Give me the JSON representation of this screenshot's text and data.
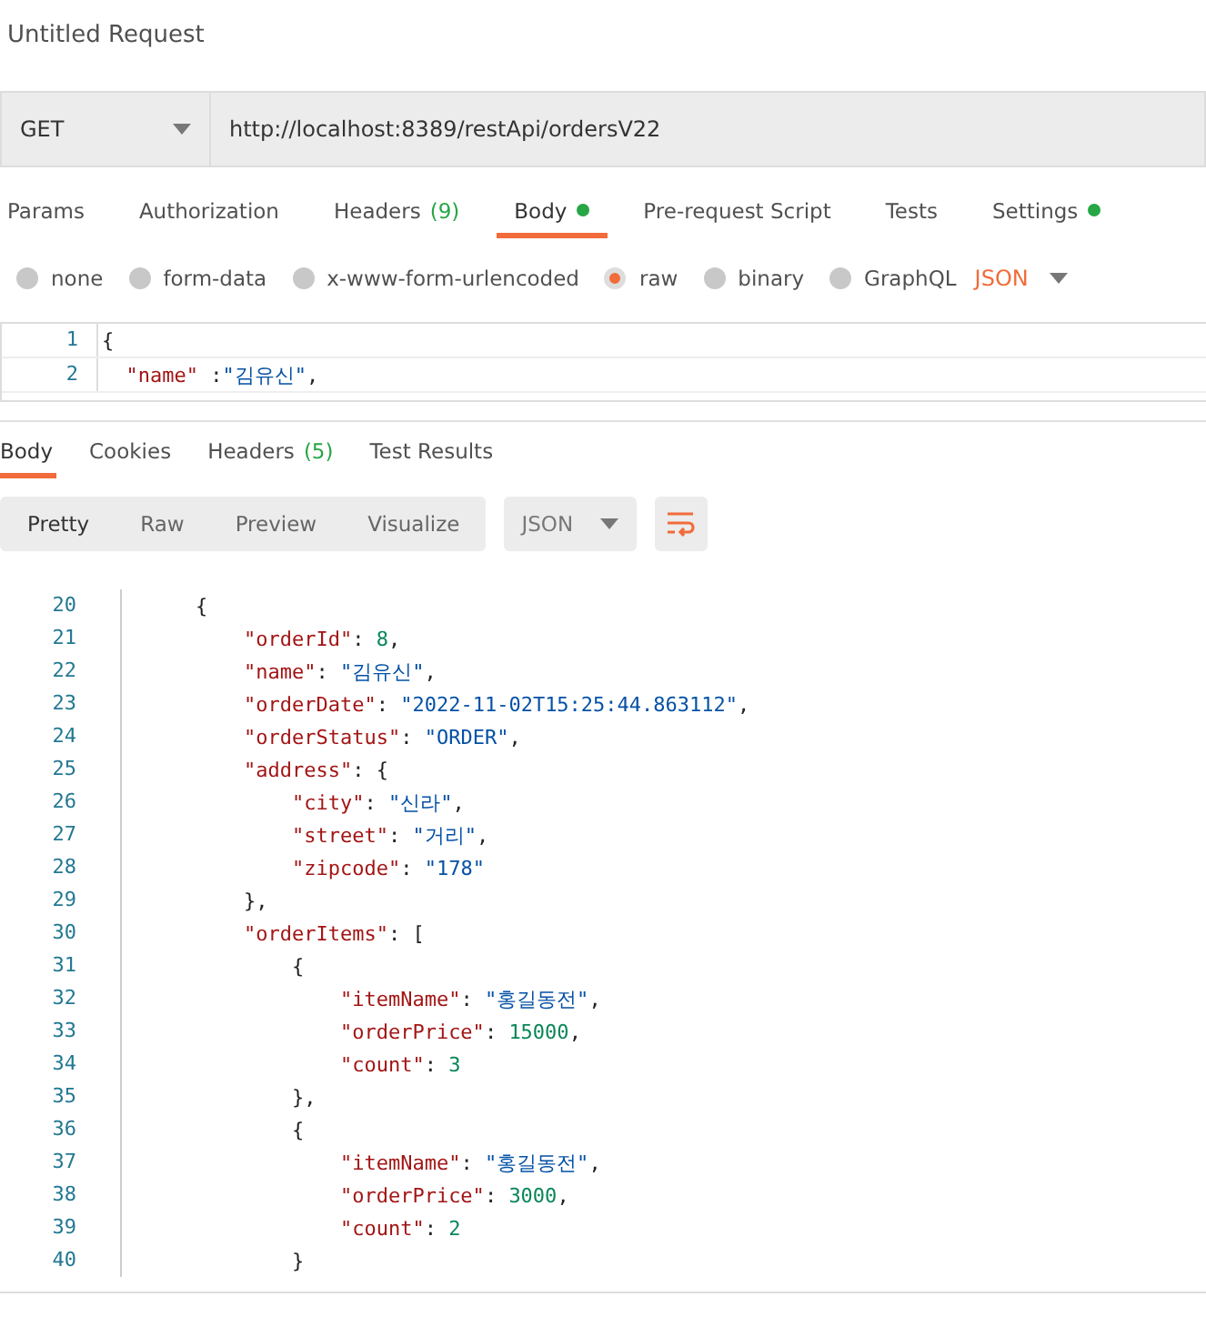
{
  "title": "Untitled Request",
  "request": {
    "method": "GET",
    "url": "http://localhost:8389/restApi/ordersV22"
  },
  "tabs": [
    {
      "label": "Params",
      "selected": false
    },
    {
      "label": "Authorization",
      "selected": false
    },
    {
      "label": "Headers",
      "count": "(9)",
      "selected": false
    },
    {
      "label": "Body",
      "dot": true,
      "selected": true
    },
    {
      "label": "Pre-request Script",
      "selected": false
    },
    {
      "label": "Tests",
      "selected": false
    },
    {
      "label": "Settings",
      "dot": true,
      "selected": false
    }
  ],
  "body_types": [
    {
      "label": "none",
      "selected": false
    },
    {
      "label": "form-data",
      "selected": false
    },
    {
      "label": "x-www-form-urlencoded",
      "selected": false
    },
    {
      "label": "raw",
      "selected": true
    },
    {
      "label": "binary",
      "selected": false
    },
    {
      "label": "GraphQL",
      "selected": false
    }
  ],
  "raw_format": "JSON",
  "editor_lines": [
    {
      "number": "1",
      "tokens": [
        {
          "kind": "punct",
          "text": "{"
        }
      ]
    },
    {
      "number": "2",
      "tokens": [
        {
          "kind": "key",
          "text": "  \"name\""
        },
        {
          "kind": "punct",
          "text": " :"
        },
        {
          "kind": "str",
          "text": "\"김유신\""
        },
        {
          "kind": "punct",
          "text": ","
        }
      ]
    }
  ],
  "response_tabs": [
    {
      "label": "Body",
      "selected": true
    },
    {
      "label": "Cookies",
      "selected": false
    },
    {
      "label": "Headers",
      "count": "(5)",
      "selected": false
    },
    {
      "label": "Test Results",
      "selected": false
    }
  ],
  "view_modes": [
    {
      "label": "Pretty",
      "selected": true
    },
    {
      "label": "Raw",
      "selected": false
    },
    {
      "label": "Preview",
      "selected": false
    },
    {
      "label": "Visualize",
      "selected": false
    }
  ],
  "response_format": "JSON",
  "response_lines": [
    {
      "number": "20",
      "tokens": [
        {
          "kind": "punct",
          "text": "    {"
        }
      ]
    },
    {
      "number": "21",
      "tokens": [
        {
          "kind": "key",
          "text": "        \"orderId\""
        },
        {
          "kind": "punct",
          "text": ": "
        },
        {
          "kind": "num",
          "text": "8"
        },
        {
          "kind": "punct",
          "text": ","
        }
      ]
    },
    {
      "number": "22",
      "tokens": [
        {
          "kind": "key",
          "text": "        \"name\""
        },
        {
          "kind": "punct",
          "text": ": "
        },
        {
          "kind": "str",
          "text": "\"김유신\""
        },
        {
          "kind": "punct",
          "text": ","
        }
      ]
    },
    {
      "number": "23",
      "tokens": [
        {
          "kind": "key",
          "text": "        \"orderDate\""
        },
        {
          "kind": "punct",
          "text": ": "
        },
        {
          "kind": "str",
          "text": "\"2022-11-02T15:25:44.863112\""
        },
        {
          "kind": "punct",
          "text": ","
        }
      ]
    },
    {
      "number": "24",
      "tokens": [
        {
          "kind": "key",
          "text": "        \"orderStatus\""
        },
        {
          "kind": "punct",
          "text": ": "
        },
        {
          "kind": "str",
          "text": "\"ORDER\""
        },
        {
          "kind": "punct",
          "text": ","
        }
      ]
    },
    {
      "number": "25",
      "tokens": [
        {
          "kind": "key",
          "text": "        \"address\""
        },
        {
          "kind": "punct",
          "text": ": {"
        }
      ]
    },
    {
      "number": "26",
      "tokens": [
        {
          "kind": "key",
          "text": "            \"city\""
        },
        {
          "kind": "punct",
          "text": ": "
        },
        {
          "kind": "str",
          "text": "\"신라\""
        },
        {
          "kind": "punct",
          "text": ","
        }
      ]
    },
    {
      "number": "27",
      "tokens": [
        {
          "kind": "key",
          "text": "            \"street\""
        },
        {
          "kind": "punct",
          "text": ": "
        },
        {
          "kind": "str",
          "text": "\"거리\""
        },
        {
          "kind": "punct",
          "text": ","
        }
      ]
    },
    {
      "number": "28",
      "tokens": [
        {
          "kind": "key",
          "text": "            \"zipcode\""
        },
        {
          "kind": "punct",
          "text": ": "
        },
        {
          "kind": "str",
          "text": "\"178\""
        }
      ]
    },
    {
      "number": "29",
      "tokens": [
        {
          "kind": "punct",
          "text": "        },"
        }
      ]
    },
    {
      "number": "30",
      "tokens": [
        {
          "kind": "key",
          "text": "        \"orderItems\""
        },
        {
          "kind": "punct",
          "text": ": ["
        }
      ]
    },
    {
      "number": "31",
      "tokens": [
        {
          "kind": "punct",
          "text": "            {"
        }
      ]
    },
    {
      "number": "32",
      "tokens": [
        {
          "kind": "key",
          "text": "                \"itemName\""
        },
        {
          "kind": "punct",
          "text": ": "
        },
        {
          "kind": "str",
          "text": "\"홍길동전\""
        },
        {
          "kind": "punct",
          "text": ","
        }
      ]
    },
    {
      "number": "33",
      "tokens": [
        {
          "kind": "key",
          "text": "                \"orderPrice\""
        },
        {
          "kind": "punct",
          "text": ": "
        },
        {
          "kind": "num",
          "text": "15000"
        },
        {
          "kind": "punct",
          "text": ","
        }
      ]
    },
    {
      "number": "34",
      "tokens": [
        {
          "kind": "key",
          "text": "                \"count\""
        },
        {
          "kind": "punct",
          "text": ": "
        },
        {
          "kind": "num",
          "text": "3"
        }
      ]
    },
    {
      "number": "35",
      "tokens": [
        {
          "kind": "punct",
          "text": "            },"
        }
      ]
    },
    {
      "number": "36",
      "tokens": [
        {
          "kind": "punct",
          "text": "            {"
        }
      ]
    },
    {
      "number": "37",
      "tokens": [
        {
          "kind": "key",
          "text": "                \"itemName\""
        },
        {
          "kind": "punct",
          "text": ": "
        },
        {
          "kind": "str",
          "text": "\"홍길동전\""
        },
        {
          "kind": "punct",
          "text": ","
        }
      ]
    },
    {
      "number": "38",
      "tokens": [
        {
          "kind": "key",
          "text": "                \"orderPrice\""
        },
        {
          "kind": "punct",
          "text": ": "
        },
        {
          "kind": "num",
          "text": "3000"
        },
        {
          "kind": "punct",
          "text": ","
        }
      ]
    },
    {
      "number": "39",
      "tokens": [
        {
          "kind": "key",
          "text": "                \"count\""
        },
        {
          "kind": "punct",
          "text": ": "
        },
        {
          "kind": "num",
          "text": "2"
        }
      ]
    },
    {
      "number": "40",
      "tokens": [
        {
          "kind": "punct",
          "text": "            }"
        }
      ]
    }
  ]
}
